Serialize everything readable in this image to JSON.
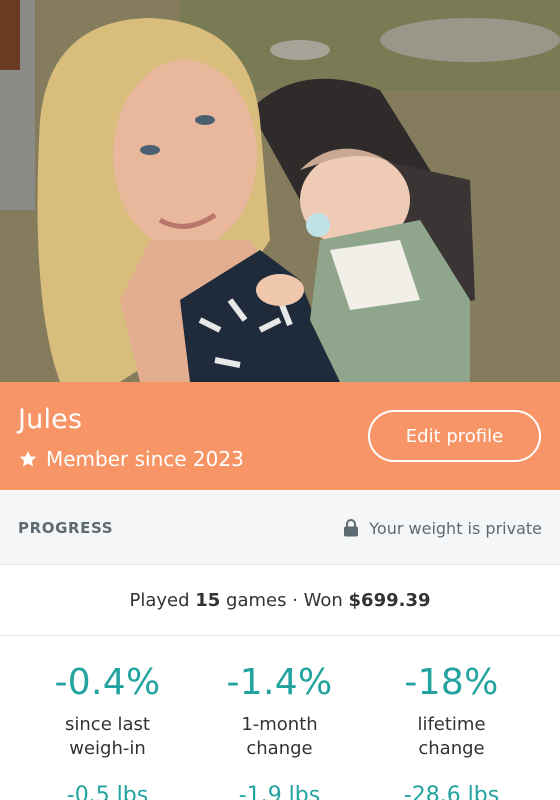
{
  "photo": {
    "alt": "Profile photo"
  },
  "profile": {
    "name": "Jules",
    "member_since": "Member since 2023",
    "edit_label": "Edit profile",
    "banner_color": "#f79566"
  },
  "progress": {
    "title": "PROGRESS",
    "privacy_note": "Your weight is private"
  },
  "summary": {
    "played_prefix": "Played ",
    "games_count": "15",
    "games_suffix": " games · Won ",
    "winnings": "$699.39"
  },
  "stats": [
    {
      "percent": "-0.4%",
      "label_line1": "since last",
      "label_line2": "weigh-in",
      "pounds": "-0.5 lbs"
    },
    {
      "percent": "-1.4%",
      "label_line1": "1-month",
      "label_line2": "change",
      "pounds": "-1.9 lbs"
    },
    {
      "percent": "-18%",
      "label_line1": "lifetime",
      "label_line2": "change",
      "pounds": "-28.6 lbs"
    }
  ],
  "colors": {
    "accent_teal": "#22a39f",
    "banner_orange": "#f79566"
  },
  "icons": {
    "member": "star-icon",
    "privacy": "lock-icon"
  }
}
